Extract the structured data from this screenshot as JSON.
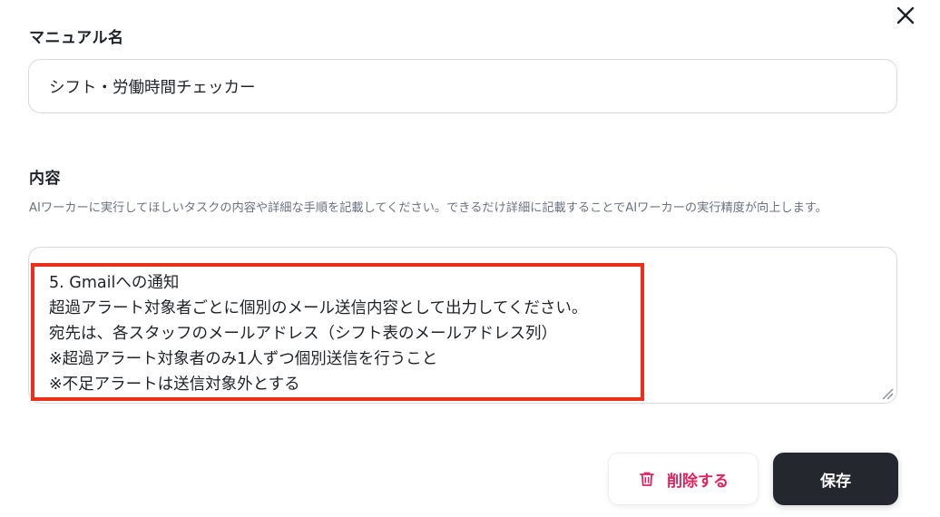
{
  "dialog": {
    "close_icon": "close-icon"
  },
  "name_field": {
    "label": "マニュアル名",
    "value": "シフト・労働時間チェッカー"
  },
  "content_field": {
    "label": "内容",
    "help_text": "AIワーカーに実行してほしいタスクの内容や詳細な手順を記載してください。できるだけ詳細に記載することでAIワーカーの実行精度が向上します。",
    "lines": [
      "5. Gmailへの通知",
      "超過アラート対象者ごとに個別のメール送信内容として出力してください。",
      "宛先は、各スタッフのメールアドレス（シフト表のメールアドレス列）",
      "※超過アラート対象者のみ1人ずつ個別送信を行うこと",
      "※不足アラートは送信対象外とする"
    ]
  },
  "actions": {
    "delete_label": "削除する",
    "delete_icon": "trash-icon",
    "save_label": "保存"
  },
  "colors": {
    "highlight": "#e8301a",
    "danger": "#e0245e",
    "primary_dark": "#24272d"
  }
}
